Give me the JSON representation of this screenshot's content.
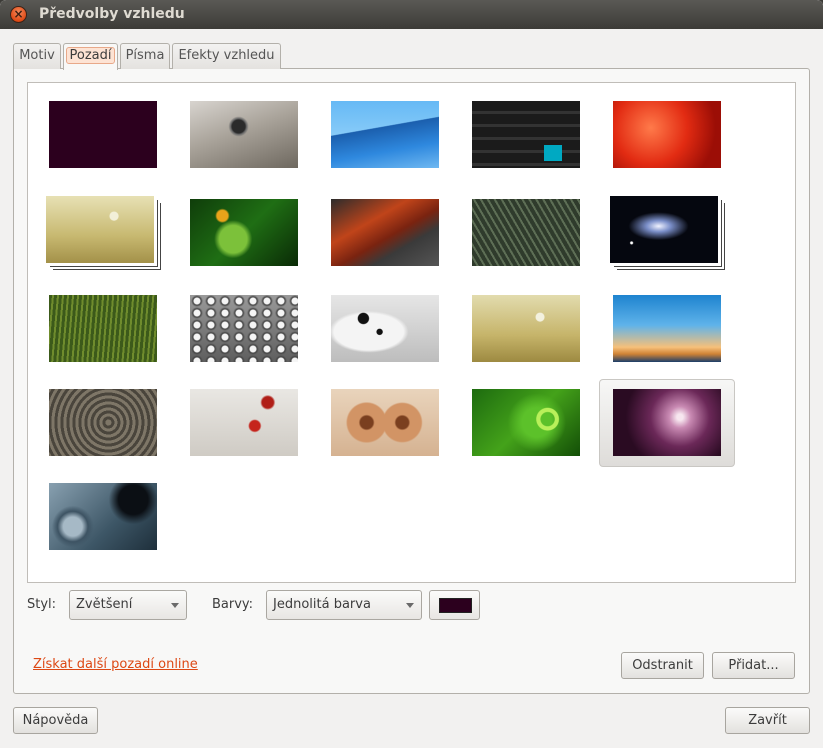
{
  "window": {
    "title": "Předvolby vzhledu"
  },
  "tabs": [
    "Motiv",
    "Pozadí",
    "Písma",
    "Efekty vzhledu"
  ],
  "active_tab": 1,
  "background": {
    "style_label": "Styl:",
    "style_value": "Zvětšení",
    "colors_label": "Barvy:",
    "colors_value": "Jednolitá barva",
    "selected_color": "#2c001e",
    "selected_wallpaper_index": 19,
    "wallpapers": [
      "solid-aubergine",
      "snail",
      "blue-sail",
      "dark-wood",
      "red-tomato",
      "meadow-flower",
      "green-plant",
      "red-leaf",
      "fern-leaf",
      "galaxy",
      "grass-field",
      "water-drops",
      "dalmatian-dog",
      "meadow-dandelion",
      "sky-sunset",
      "rope",
      "red-leaves-mist",
      "cinnamon",
      "green-curl",
      "ubuntu-purple-light",
      "glass-marbles"
    ]
  },
  "link_more": "Získat další pozadí online",
  "buttons": {
    "remove": "Odstranit",
    "add": "Přidat...",
    "help": "Nápověda",
    "close": "Zavřít"
  },
  "colors": {
    "accent": "#dd4814",
    "aubergine": "#2c001e"
  }
}
